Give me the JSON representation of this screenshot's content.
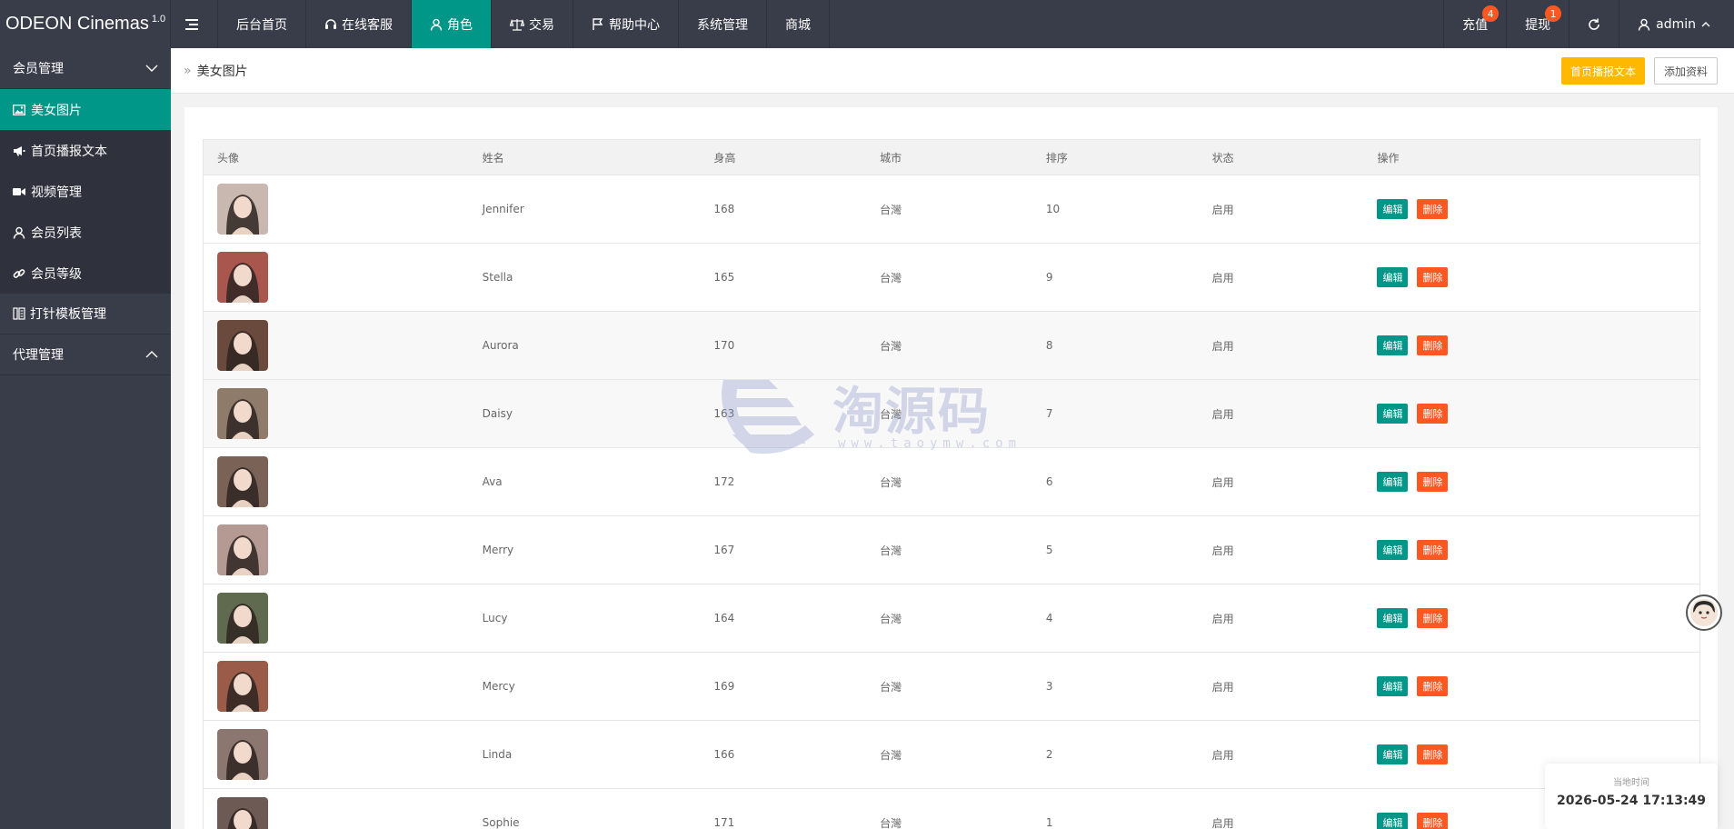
{
  "brand": {
    "name": "ODEON Cinemas",
    "version": "1.0"
  },
  "top_nav": [
    {
      "label": "后台首页",
      "icon": ""
    },
    {
      "label": "在线客服",
      "icon": "headset-icon"
    },
    {
      "label": "角色",
      "icon": "user-icon",
      "active": true
    },
    {
      "label": "交易",
      "icon": "scale-icon"
    },
    {
      "label": "帮助中心",
      "icon": "flag-icon"
    },
    {
      "label": "系统管理",
      "icon": ""
    },
    {
      "label": "商城",
      "icon": ""
    }
  ],
  "right_nav": {
    "recharge": {
      "label": "充值",
      "badge": "4"
    },
    "withdraw": {
      "label": "提现",
      "badge": "1"
    },
    "refresh_icon": "refresh-icon",
    "user": {
      "label": "admin"
    }
  },
  "sidebar": {
    "group1": "会员管理",
    "items": [
      {
        "label": "美女图片",
        "icon": "image-icon",
        "active": true
      },
      {
        "label": "首页播报文本",
        "icon": "megaphone-icon"
      },
      {
        "label": "视频管理",
        "icon": "video-icon"
      },
      {
        "label": "会员列表",
        "icon": "user-icon"
      },
      {
        "label": "会员等级",
        "icon": "link-icon"
      }
    ],
    "group2": "打针模板管理",
    "group3": "代理管理"
  },
  "breadcrumb": {
    "separator": "»",
    "current": "美女图片"
  },
  "actions": {
    "broadcast": "首页播报文本",
    "add": "添加资料"
  },
  "table": {
    "headers": [
      "头像",
      "姓名",
      "身高",
      "城市",
      "排序",
      "状态",
      "操作"
    ],
    "edit_label": "编辑",
    "delete_label": "删除",
    "rows": [
      {
        "name": "Jennifer",
        "height": "168",
        "city": "台灣",
        "order": "10",
        "status": "启用",
        "tone": "#c9b8b0"
      },
      {
        "name": "Stella",
        "height": "165",
        "city": "台灣",
        "order": "9",
        "status": "启用",
        "tone": "#a9564f"
      },
      {
        "name": "Aurora",
        "height": "170",
        "city": "台灣",
        "order": "8",
        "status": "启用",
        "tone": "#6b4a3e"
      },
      {
        "name": "Daisy",
        "height": "163",
        "city": "台灣",
        "order": "7",
        "status": "启用",
        "tone": "#8f7b6a"
      },
      {
        "name": "Ava",
        "height": "172",
        "city": "台灣",
        "order": "6",
        "status": "启用",
        "tone": "#7a6356"
      },
      {
        "name": "Merry",
        "height": "167",
        "city": "台灣",
        "order": "5",
        "status": "启用",
        "tone": "#b49a92"
      },
      {
        "name": "Lucy",
        "height": "164",
        "city": "台灣",
        "order": "4",
        "status": "启用",
        "tone": "#5f6a4f"
      },
      {
        "name": "Mercy",
        "height": "169",
        "city": "台灣",
        "order": "3",
        "status": "启用",
        "tone": "#9a5c48"
      },
      {
        "name": "Linda",
        "height": "166",
        "city": "台灣",
        "order": "2",
        "status": "启用",
        "tone": "#8c7670"
      },
      {
        "name": "Sophie",
        "height": "171",
        "city": "台灣",
        "order": "1",
        "status": "启用",
        "tone": "#6e5a55"
      }
    ]
  },
  "watermark": {
    "text": "淘源码",
    "url": "www.taoymw.com"
  },
  "clock": {
    "label": "当地时间",
    "time": "2026-05-24 17:13:49"
  },
  "colors": {
    "accent": "#009688",
    "dark": "#393d49",
    "warn": "#ffb800",
    "danger": "#ff5722"
  }
}
